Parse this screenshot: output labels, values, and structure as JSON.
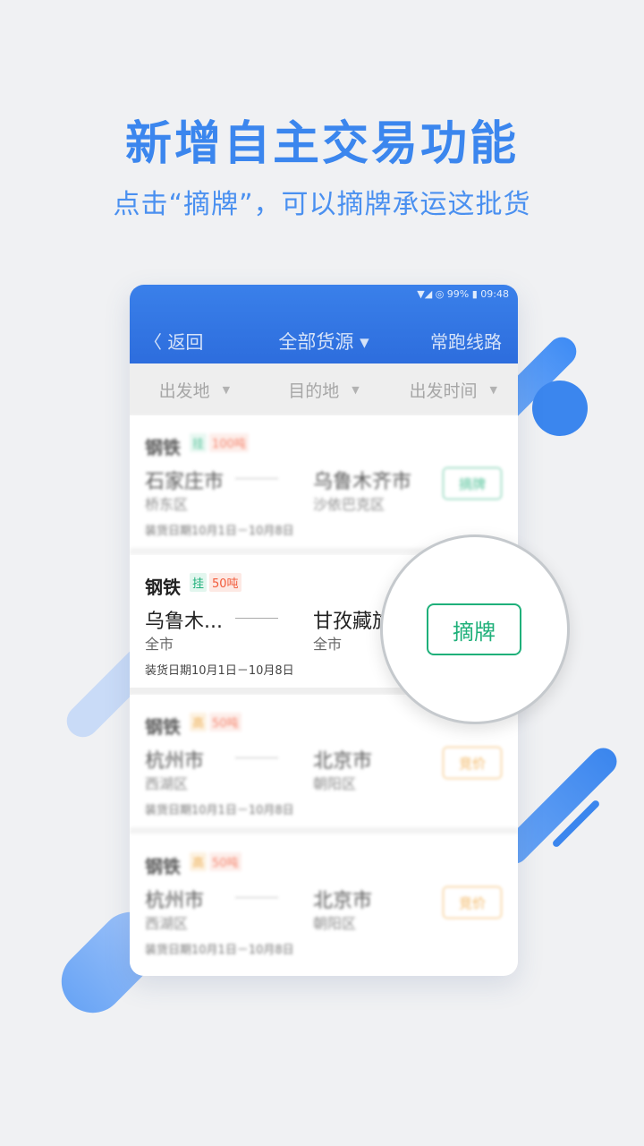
{
  "headline": "新增自主交易功能",
  "subheadline": "点击“摘牌”，可以摘牌承运这批货",
  "phone": {
    "status": "▼◢ ◎ 99% ▮ 09:48",
    "back_label": "〈 返回",
    "title": "全部货源 ▾",
    "right_link": "常跑线路",
    "filters": [
      {
        "label": "出发地"
      },
      {
        "label": "目的地"
      },
      {
        "label": "出发时间"
      }
    ],
    "cards": [
      {
        "category": "钢铁",
        "tag1": "挂",
        "tag2": "100吨",
        "from_city": "石家庄市",
        "from_district": "桥东区",
        "to_city": "乌鲁木齐市",
        "to_district": "沙依巴克区",
        "date": "装货日期10月1日－10月8日",
        "button": "摘牌",
        "style": "green"
      },
      {
        "category": "钢铁",
        "tag1": "挂",
        "tag2": "50吨",
        "from_city": "乌鲁木...",
        "from_district": "全市",
        "to_city": "甘孜藏族",
        "to_district": "全市",
        "date": "装货日期10月1日－10月8日",
        "button": "摘牌",
        "style": "green"
      },
      {
        "category": "钢铁",
        "tag1": "高",
        "tag2": "50吨",
        "from_city": "杭州市",
        "from_district": "西湖区",
        "to_city": "北京市",
        "to_district": "朝阳区",
        "date": "装货日期10月1日－10月8日",
        "button": "竞价",
        "style": "orange"
      },
      {
        "category": "钢铁",
        "tag1": "高",
        "tag2": "50吨",
        "from_city": "杭州市",
        "from_district": "西湖区",
        "to_city": "北京市",
        "to_district": "朝阳区",
        "date": "装货日期10月1日－10月8日",
        "button": "竞价",
        "style": "orange"
      }
    ]
  },
  "magnifier_button": "摘牌"
}
